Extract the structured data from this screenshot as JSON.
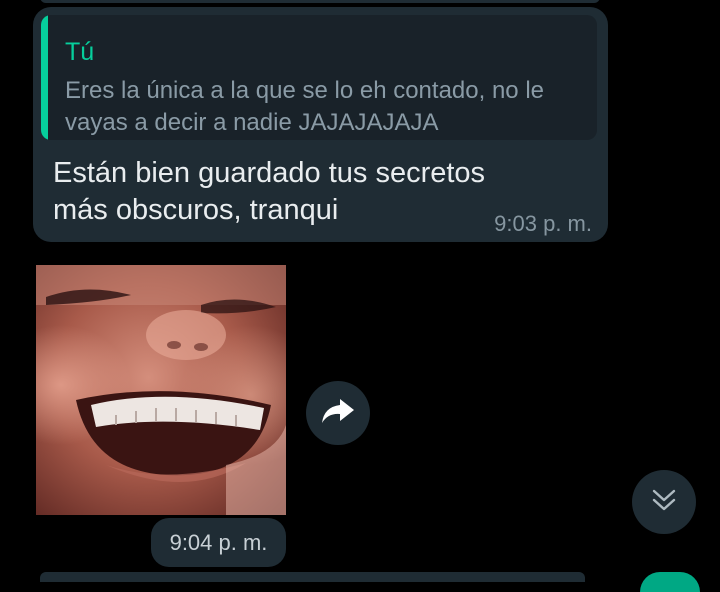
{
  "reply_message": {
    "quoted": {
      "author": "Tú",
      "text": "Eres la única a la que se lo eh contado, no le vayas a decir a nadie JAJAJAJAJA"
    },
    "text": "Están bien guardado tus secretos más obscuros, tranqui",
    "time": "9:03 p. m."
  },
  "image_message": {
    "time": "9:04 p. m."
  },
  "icons": {
    "forward": "forward-arrow-icon",
    "scroll_down": "double-chevron-down-icon"
  },
  "colors": {
    "background": "#000000",
    "bubble": "#1f2c34",
    "quote_accent": "#06cf9c",
    "text": "#e9edef",
    "meta": "#8696a0"
  }
}
